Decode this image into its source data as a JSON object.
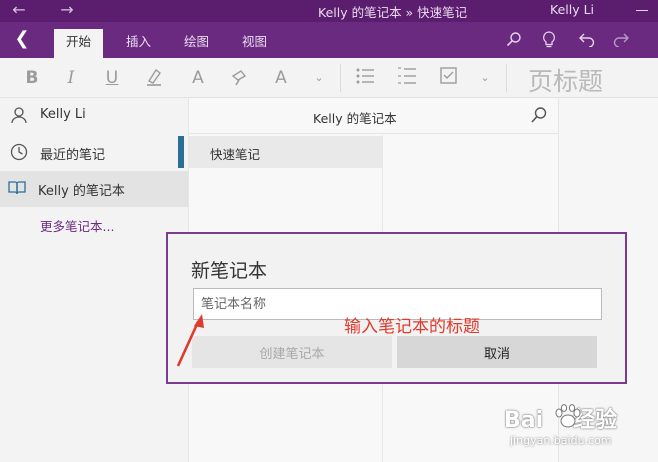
{
  "titlebar": {
    "title": "Kelly 的笔记本 » 快速笔记",
    "user": "Kelly Li",
    "back_icon": "arrow-left-icon",
    "forward_icon": "arrow-right-icon"
  },
  "ribbon": {
    "tabs": [
      {
        "label": "开始",
        "active": true
      },
      {
        "label": "插入",
        "active": false
      },
      {
        "label": "绘图",
        "active": false
      },
      {
        "label": "视图",
        "active": false
      }
    ],
    "right_icons": [
      "search-icon",
      "lightbulb-icon",
      "undo-icon",
      "redo-icon"
    ]
  },
  "toolbar": {
    "bold": "B",
    "italic": "I",
    "underline": "U",
    "font_color": "A",
    "clear_format": "A",
    "page_title_placeholder": "页标题"
  },
  "sidebar": {
    "user_name": "Kelly Li",
    "recent_notes": "最近的笔记",
    "notebook": "Kelly 的笔记本",
    "more_notebooks": "更多笔记本..."
  },
  "sections": {
    "notebook_title": "Kelly 的笔记本",
    "items": [
      {
        "label": "快速笔记"
      }
    ]
  },
  "dialog": {
    "title": "新笔记本",
    "name_placeholder": "笔记本名称",
    "create_button": "创建笔记本",
    "cancel_button": "取消"
  },
  "annotation": {
    "text": "输入笔记本的标题"
  },
  "watermark": {
    "brand": "Bai",
    "brand_tail": "经验",
    "url": "jingyan.baidu.com"
  },
  "colors": {
    "titlebar": "#5b1d6e",
    "ribbon": "#6a2a80",
    "annotation": "#e03a2c",
    "section_accent": "#2a6f97"
  }
}
